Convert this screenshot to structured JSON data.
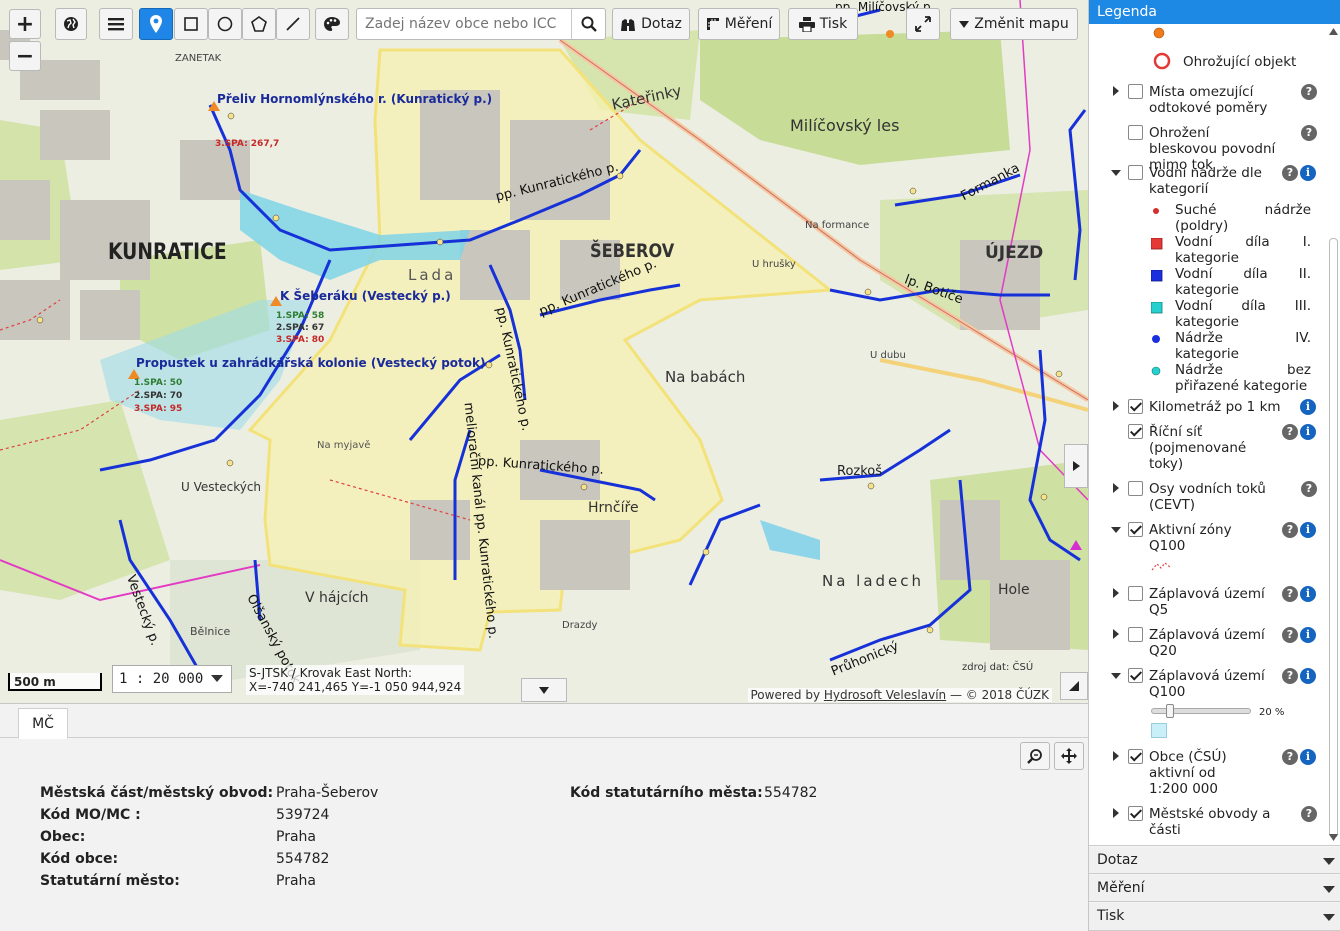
{
  "toolbar": {
    "search_placeholder": "Zadej název obce nebo ICC",
    "query_label": "Dotaz",
    "measure_label": "Měření",
    "print_label": "Tisk",
    "change_map_label": "Změnit mapu"
  },
  "map": {
    "scale_bar_label": "500 m",
    "scale_value": "1 : 20 000",
    "crs_line": "S-JTSK / Krovak East North:",
    "coords_line": "X=-740 241,465 Y=-1 050 944,924",
    "attribution_prefix": "Powered by",
    "attribution_link": "Hydrosoft Veleslavín",
    "attribution_suffix": "— © 2018 ČÚZK",
    "source_note": "zdroj dat: ČSÚ",
    "places": {
      "kunratice": "KUNRATICE",
      "seberov": "ŠEBEROV",
      "ujezd": "ÚJEZD",
      "katerinky": "Kateřinky",
      "milicovsky_les": "Milíčovský les",
      "na_babach": "Na babách",
      "na_ladech": "Na ladech",
      "v_hajcich": "V hájcích",
      "u_vesteckych": "U Vesteckých",
      "hrncire": "Hrnčíře",
      "rozkos": "Rozkoš",
      "hole": "Hole",
      "lada": "Lada",
      "na_myjave": "Na myjavě",
      "zanetak": "ZANETAK",
      "formanka": "Formanka",
      "belnice": "Bělnice",
      "drazdy": "Drazdy",
      "na_formance": "Na formance",
      "u_hrusky": "U hrušky",
      "u_dubu": "U dubu"
    },
    "rivers": {
      "kunraticky1": "pp. Kunratického p.",
      "kunraticky2": "pp. Kunratického p.",
      "kunraticky3": "pp. Kunratického p.",
      "kunraticky4": "pp. Kunratického p.",
      "melioracni": "meliorační kanál pp. Kunratického p.",
      "vestecky": "Vestecký p.",
      "olsansky": "Olšanský potok",
      "botic": "lp. Botiče",
      "pruhonicky": "Průhonický",
      "milicovsky": "pp. Milíčovský p."
    },
    "stations": [
      {
        "name": "Přeliv Hornomlýnského r. (Kunratický p.)",
        "spa3": "3.SPA: 267,7"
      },
      {
        "name": "K Šeberáku (Vestecký p.)",
        "spa1": "1.SPA: 58",
        "spa2": "2.SPA: 67",
        "spa3": "3.SPA: 80"
      },
      {
        "name": "Propustek u zahrádkářská kolonie (Vestecký potok)",
        "spa1": "1.SPA: 50",
        "spa2": "2.SPA: 70",
        "spa3": "3.SPA: 95"
      }
    ]
  },
  "bottom_panel": {
    "tab_label": "MČ",
    "fields_left": [
      {
        "key": "Městská část/městský obvod:",
        "value": "Praha-Šeberov"
      },
      {
        "key": "Kód MO/MC :",
        "value": "539724"
      },
      {
        "key": "Obec:",
        "value": "Praha"
      },
      {
        "key": "Kód obce:",
        "value": "554782"
      },
      {
        "key": "Statutární město:",
        "value": "Praha"
      }
    ],
    "fields_right": [
      {
        "key": "Kód statutárního města:",
        "value": "554782"
      }
    ]
  },
  "legend": {
    "title": "Legenda",
    "threat_object": "Ohrožující objekt",
    "items": {
      "mista": "Místa omezující odtokové poměry",
      "blesk": "Ohrožení bleskovou povodní mimo tok",
      "nadrze": "Vodní nádrže dle kategorií",
      "km": "Kilometráž po 1 km",
      "ricni": "Říční síť (pojmenované toky)",
      "osy": "Osy vodních toků (CEVT)",
      "aktivni": "Aktivní zóny Q100",
      "q5": "Záplavová území Q5",
      "q20": "Záplavová území Q20",
      "q100": "Záplavová území Q100",
      "obce": "Obce (ČSÚ) aktivní od 1:200 000",
      "mestske": "Městské obvody a části"
    },
    "nadrze_sub": [
      {
        "a": "Suché nádrže",
        "b": "(poldry)",
        "color": "#d32f2f"
      },
      {
        "a": "Vodní díla I.",
        "b": "kategorie",
        "color": "#e53935"
      },
      {
        "a": "Vodní díla II.",
        "b": "kategorie",
        "color": "#1a2fe0"
      },
      {
        "a": "Vodní díla III.",
        "b": "kategorie",
        "color": "#26d0ce"
      },
      {
        "a": "Nádrže IV.",
        "b": "kategorie",
        "color": "#1a2fe0"
      },
      {
        "a": "Nádrže bez",
        "b": "přiřazené kategorie",
        "color": "#26d0ce"
      }
    ],
    "opacity_label": "20 %",
    "opacity_value": 20,
    "accordion": [
      "Dotaz",
      "Měření",
      "Tisk"
    ]
  }
}
